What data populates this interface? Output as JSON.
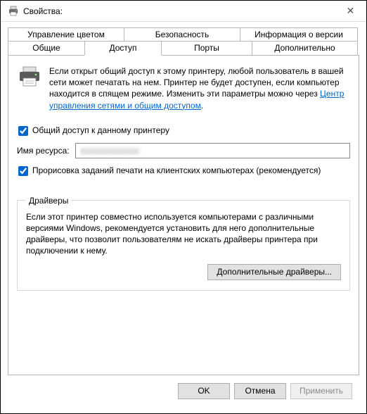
{
  "window": {
    "title": "Свойства:",
    "close_glyph": "✕"
  },
  "tabs": {
    "row1": {
      "color": "Управление цветом",
      "security": "Безопасность",
      "version": "Информация о версии"
    },
    "row2": {
      "general": "Общие",
      "sharing": "Доступ",
      "ports": "Порты",
      "advanced": "Дополнительно"
    }
  },
  "intro": {
    "text1": "Если открыт общий доступ к этому принтеру, любой пользователь в вашей сети может печатать на нем. Принтер не будет доступен, если компьютер находится в спящем режиме. Изменить эти параметры можно через ",
    "link": "Центр управления сетями и общим доступом",
    "period": "."
  },
  "share": {
    "cb_label": "Общий доступ к данному принтеру",
    "name_label": "Имя ресурса:",
    "name_value": "xxxxxxxxxxxxxx",
    "render_label": "Прорисовка заданий печати на клиентских компьютерах (рекомендуется)"
  },
  "drivers": {
    "legend": "Драйверы",
    "text": "Если этот принтер совместно используется компьютерами с различными версиями Windows, рекомендуется установить для него дополнительные драйверы, что позволит пользователям не искать драйверы принтера при подключении к нему.",
    "button": "Дополнительные драйверы..."
  },
  "footer": {
    "ok": "OK",
    "cancel": "Отмена",
    "apply": "Применить"
  }
}
